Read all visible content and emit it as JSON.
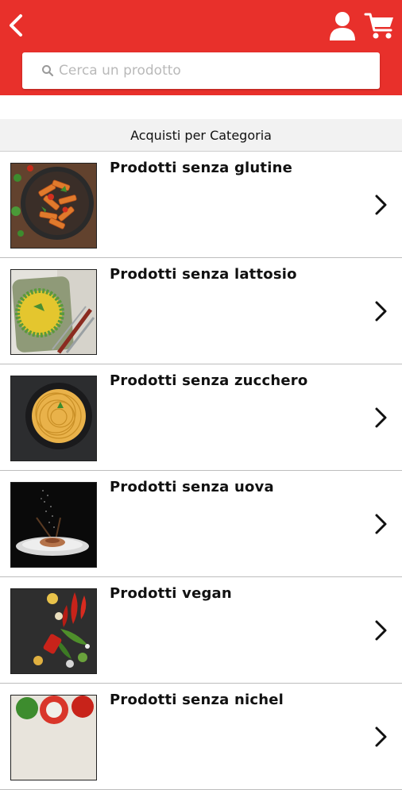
{
  "header": {
    "background": "#e8302b",
    "icons": [
      "back-icon",
      "user-icon",
      "cart-icon"
    ]
  },
  "search": {
    "placeholder": "Cerca un prodotto",
    "value": ""
  },
  "section": {
    "title": "Acquisti per Categoria"
  },
  "categories": [
    {
      "label": "Prodotti senza glutine",
      "image": "penne-pasta-dish"
    },
    {
      "label": "Prodotti senza lattosio",
      "image": "rice-pea-dish"
    },
    {
      "label": "Prodotti senza zucchero",
      "image": "spaghetti-bowl"
    },
    {
      "label": "Prodotti senza uova",
      "image": "plated-noodles"
    },
    {
      "label": "Prodotti vegan",
      "image": "vegetables-spread"
    },
    {
      "label": "Prodotti senza nichel",
      "image": "tomato-salad"
    }
  ]
}
